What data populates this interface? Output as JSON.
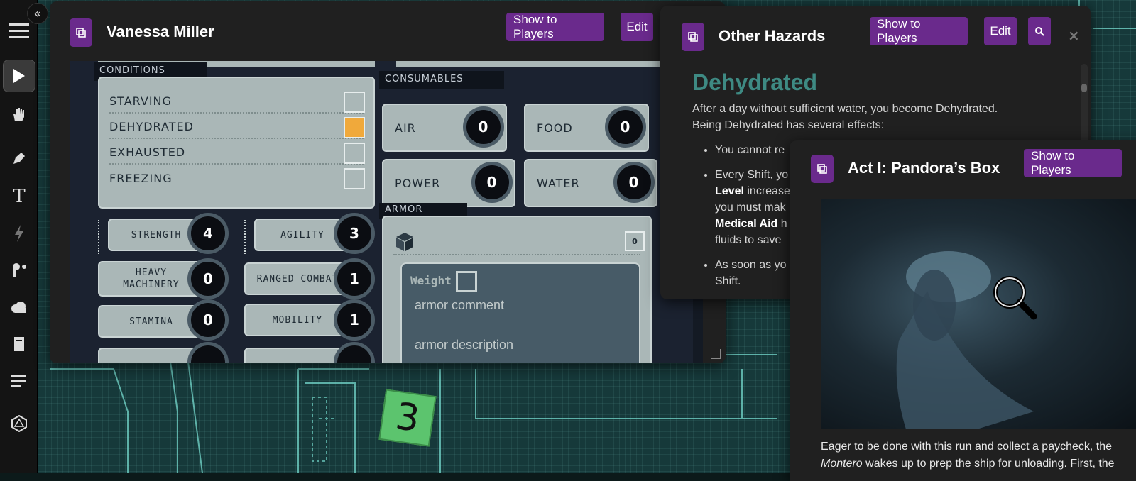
{
  "map": {
    "token_label": "3"
  },
  "sidebar": {
    "tools": [
      "menu-icon",
      "select-icon",
      "hand-icon",
      "pen-icon",
      "text-icon",
      "bolt-icon",
      "paint-icon",
      "cloud-icon",
      "journal-icon",
      "list-icon",
      "dice-icon"
    ]
  },
  "character": {
    "title": "Vanessa Miller",
    "show_label": "Show to Players",
    "edit_label": "Edit",
    "conditions_heading": "CONDITIONS",
    "conditions": [
      {
        "label": "STARVING",
        "checked": false
      },
      {
        "label": "DEHYDRATED",
        "checked": true
      },
      {
        "label": "EXHAUSTED",
        "checked": false
      },
      {
        "label": "FREEZING",
        "checked": false
      }
    ],
    "consumables_heading": "CONSUMABLES",
    "consumables": [
      {
        "label": "AIR",
        "value": "0"
      },
      {
        "label": "FOOD",
        "value": "0"
      },
      {
        "label": "POWER",
        "value": "0"
      },
      {
        "label": "WATER",
        "value": "0"
      }
    ],
    "stats": [
      {
        "label": "STRENGTH",
        "value": "4"
      },
      {
        "label": "AGILITY",
        "value": "3"
      },
      {
        "label": "HEAVY\nMACHINERY",
        "value": "0"
      },
      {
        "label": "RANGED COMBAT",
        "value": "1"
      },
      {
        "label": "STAMINA",
        "value": "0"
      },
      {
        "label": "MOBILITY",
        "value": "1"
      }
    ],
    "armor": {
      "heading": "ARMOR",
      "rating": "0",
      "weight_label": "Weight",
      "comment_placeholder": "armor comment",
      "description_placeholder": "armor description"
    }
  },
  "hazards": {
    "title": "Other Hazards",
    "show_label": "Show to Players",
    "edit_label": "Edit",
    "close_label": "×",
    "heading": "Dehydrated",
    "intro_1": "After a day without sufficient water, you become Dehydrated.",
    "intro_2": "Being Dehydrated has several effects:",
    "bullet_1": "You cannot re",
    "bullet_2_a": "Every Shift, yo",
    "bullet_2_b": "Level",
    "bullet_2_c": " increase",
    "bullet_2_d": "you must mak",
    "bullet_2_e": "Medical Aid",
    "bullet_2_f": " h",
    "bullet_2_g": "fluids to save",
    "bullet_3_a": "As soon as yo",
    "bullet_3_b": "Shift."
  },
  "act": {
    "title": "Act I: Pandora’s Box",
    "show_label": "Show to Players",
    "body_1": "Eager to be done with this run and collect a paycheck, the",
    "body_2_em": "Montero",
    "body_2": " wakes up to prep the ship for unloading. First, the"
  }
}
